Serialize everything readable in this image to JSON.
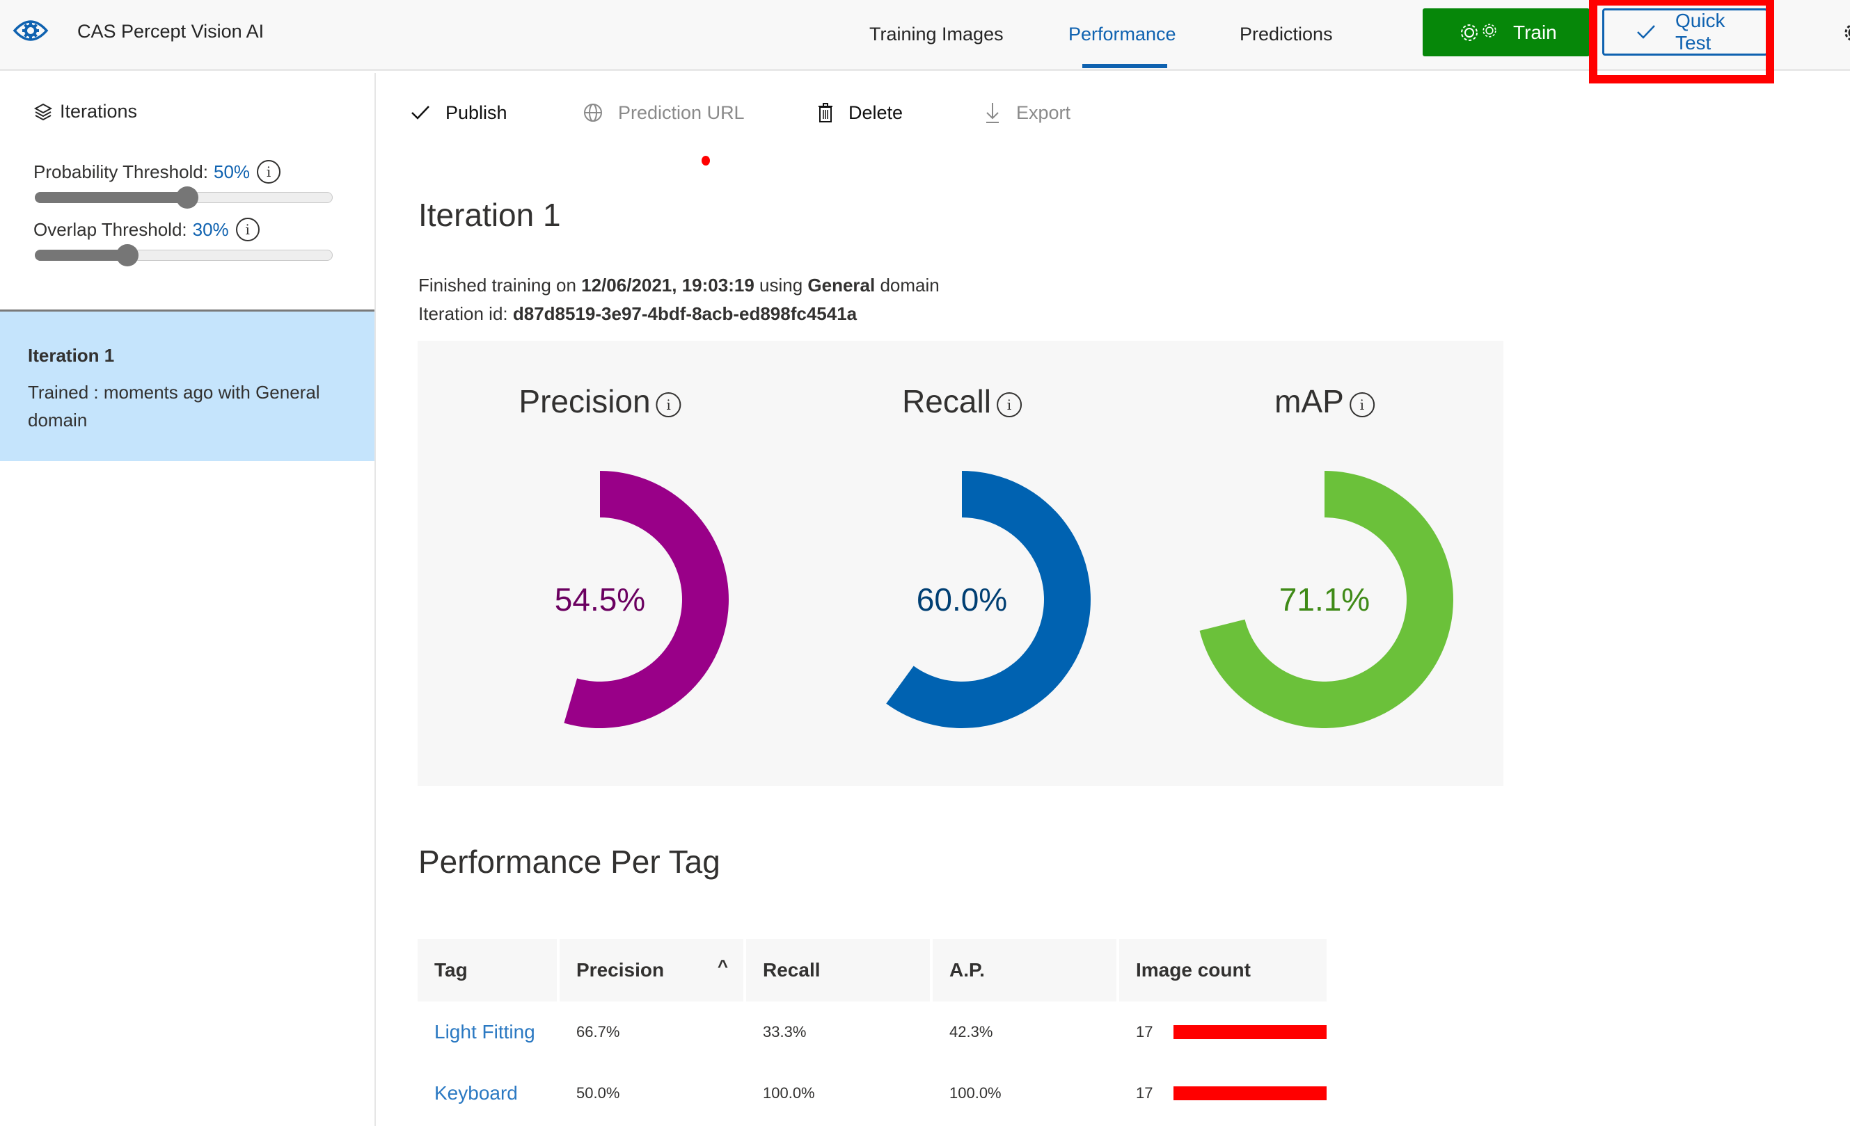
{
  "header": {
    "app_title": "CAS Percept Vision AI",
    "logo_icon": "eye-gear-icon",
    "tabs": [
      {
        "label": "Training Images",
        "active": false
      },
      {
        "label": "Performance",
        "active": true
      },
      {
        "label": "Predictions",
        "active": false
      }
    ],
    "train_button": {
      "label": "Train",
      "icon": "gears-icon",
      "color": "#068709"
    },
    "quick_test_button": {
      "label": "Quick Test",
      "icon": "check-icon",
      "color": "#0f62b0"
    },
    "highlight_color": "#ff0000"
  },
  "sidebar": {
    "heading": "Iterations",
    "probability_threshold": {
      "label": "Probability Threshold:",
      "value_text": "50%",
      "value": 0.5
    },
    "overlap_threshold": {
      "label": "Overlap Threshold:",
      "value_text": "30%",
      "value": 0.3
    },
    "iterations": [
      {
        "name": "Iteration 1",
        "description": "Trained : moments ago with General domain",
        "selected": true
      }
    ]
  },
  "toolbar": {
    "items": [
      {
        "label": "Publish",
        "icon": "check-icon",
        "enabled": true
      },
      {
        "label": "Prediction URL",
        "icon": "globe-icon",
        "enabled": false
      },
      {
        "label": "Delete",
        "icon": "trash-icon",
        "enabled": true
      },
      {
        "label": "Export",
        "icon": "download-icon",
        "enabled": false
      }
    ]
  },
  "main": {
    "title": "Iteration 1",
    "info": {
      "prefix": "Finished training on ",
      "timestamp": "12/06/2021, 19:03:19",
      "middle": " using ",
      "domain": "General",
      "suffix": " domain",
      "id_label": "Iteration id: ",
      "id_value": "d87d8519-3e97-4bdf-8acb-ed898fc4541a"
    },
    "section_title": "Performance Per Tag"
  },
  "chart_data": [
    {
      "type": "pie",
      "title": "Precision",
      "value": 54.5,
      "label": "54.5%",
      "unit": "%",
      "color": "#990088",
      "text_color": "#6b0060"
    },
    {
      "type": "pie",
      "title": "Recall",
      "value": 60.0,
      "label": "60.0%",
      "unit": "%",
      "color": "#0062b1",
      "text_color": "#003f73"
    },
    {
      "type": "pie",
      "title": "mAP",
      "value": 71.1,
      "label": "71.1%",
      "unit": "%",
      "color": "#6bc13a",
      "text_color": "#3f8a17"
    }
  ],
  "table": {
    "columns": [
      "Tag",
      "Precision",
      "Recall",
      "A.P.",
      "Image count"
    ],
    "sorted_column": "Precision",
    "sort_direction": "ascending",
    "rows": [
      {
        "tag": "Light Fitting",
        "precision": "66.7%",
        "recall": "33.3%",
        "ap": "42.3%",
        "image_count": "17",
        "count_fraction": 1.0
      },
      {
        "tag": "Keyboard",
        "precision": "50.0%",
        "recall": "100.0%",
        "ap": "100.0%",
        "image_count": "17",
        "count_fraction": 1.0
      }
    ],
    "bar_color": "#ff0000"
  }
}
